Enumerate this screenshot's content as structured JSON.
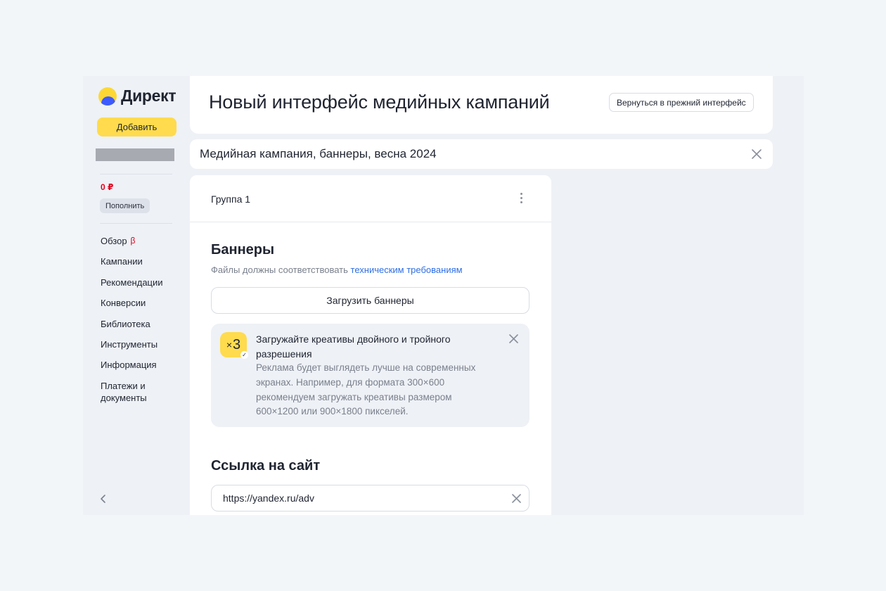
{
  "sidebar": {
    "logo_text": "Директ",
    "add_button": "Добавить",
    "balance": "0 ₽",
    "topup_button": "Пополнить",
    "nav": [
      {
        "label": "Обзор",
        "badge": "β"
      },
      {
        "label": "Кампании"
      },
      {
        "label": "Рекомендации"
      },
      {
        "label": "Конверсии"
      },
      {
        "label": "Библиотека"
      },
      {
        "label": "Инструменты"
      },
      {
        "label": "Информация"
      },
      {
        "label": "Платежи и документы"
      }
    ],
    "collapse_icon": "chevron-left-icon"
  },
  "header": {
    "title": "Новый интерфейс медийных кампаний",
    "back_button": "Вернуться в прежний интерфейс"
  },
  "campaign": {
    "name": "Медийная кампания, баннеры, весна 2024"
  },
  "group": {
    "title": "Группа 1",
    "menu_icon": "kebab-menu-icon"
  },
  "banners": {
    "title": "Баннеры",
    "subtitle_prefix": "Файлы должны соответствовать",
    "subtitle_link": "техническим требованиям",
    "upload_button": "Загрузить баннеры"
  },
  "tip": {
    "badge_prefix": "×",
    "badge_number": "3",
    "title": "Загружайте креативы двойного и тройного разрешения",
    "text": "Реклама будет выглядеть лучше на современных экранах. Например, для формата 300×600 рекомендуем загружать креативы размером 600×1200 или 900×1800 пикселей."
  },
  "site_link": {
    "title": "Ссылка на сайт",
    "value": "https://yandex.ru/adv"
  },
  "colors": {
    "accent_yellow": "#ffdb4d",
    "link_blue": "#2f6fe4",
    "beta_red": "#e0001a"
  }
}
